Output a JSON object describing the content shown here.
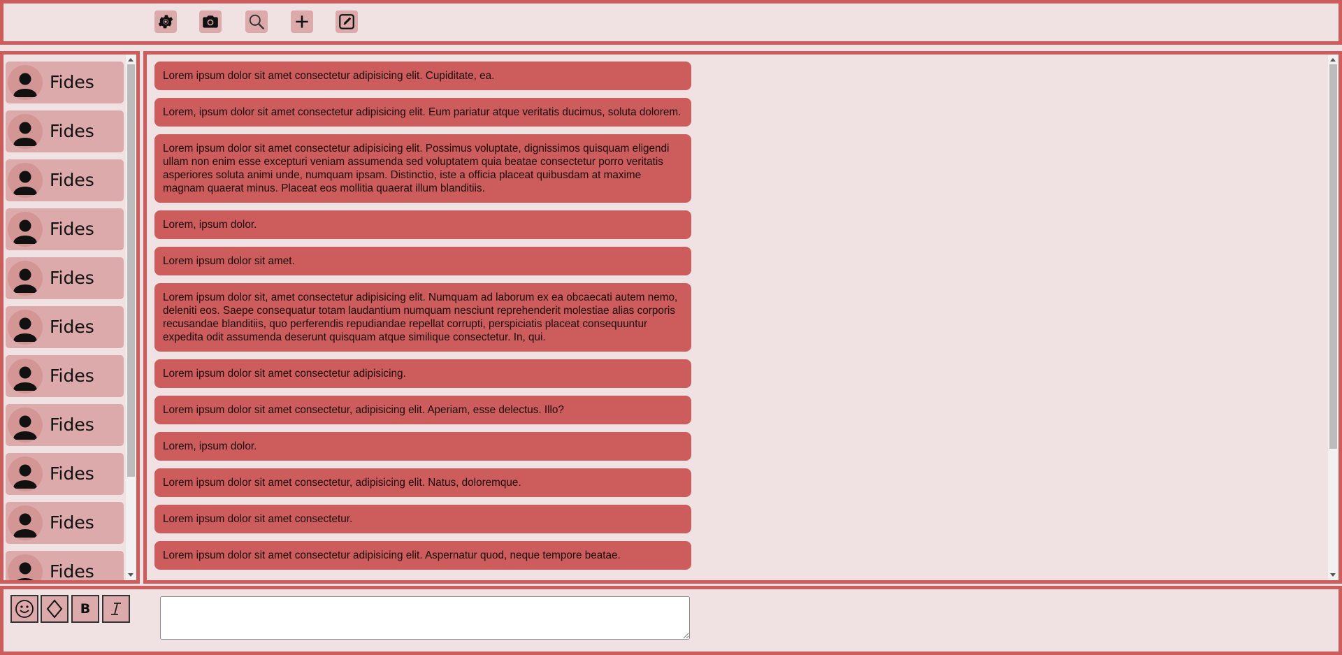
{
  "toolbar": {
    "icons": [
      "settings-icon",
      "camera-icon",
      "search-icon",
      "plus-icon",
      "edit-icon"
    ]
  },
  "sidebar": {
    "contacts": [
      {
        "name": "Fides"
      },
      {
        "name": "Fides"
      },
      {
        "name": "Fides"
      },
      {
        "name": "Fides"
      },
      {
        "name": "Fides"
      },
      {
        "name": "Fides"
      },
      {
        "name": "Fides"
      },
      {
        "name": "Fides"
      },
      {
        "name": "Fides"
      },
      {
        "name": "Fides"
      },
      {
        "name": "Fides"
      }
    ]
  },
  "messages": [
    "Lorem ipsum dolor sit amet consectetur adipisicing elit. Cupiditate, ea.",
    "Lorem, ipsum dolor sit amet consectetur adipisicing elit. Eum pariatur atque veritatis ducimus, soluta dolorem.",
    "Lorem ipsum dolor sit amet consectetur adipisicing elit. Possimus voluptate, dignissimos quisquam eligendi ullam non enim esse excepturi veniam assumenda sed voluptatem quia beatae consectetur porro veritatis asperiores soluta animi unde, numquam ipsam. Distinctio, iste a officia placeat quibusdam at maxime magnam quaerat minus. Placeat eos mollitia quaerat illum blanditiis.",
    "Lorem, ipsum dolor.",
    "Lorem ipsum dolor sit amet.",
    "Lorem ipsum dolor sit, amet consectetur adipisicing elit. Numquam ad laborum ex ea obcaecati autem nemo, deleniti eos. Saepe consequatur totam laudantium numquam nesciunt reprehenderit molestiae alias corporis recusandae blanditiis, quo perferendis repudiandae repellat corrupti, perspiciatis placeat consequuntur expedita odit assumenda deserunt quisquam atque similique consectetur. In, qui.",
    "Lorem ipsum dolor sit amet consectetur adipisicing.",
    "Lorem ipsum dolor sit amet consectetur, adipisicing elit. Aperiam, esse delectus. Illo?",
    "Lorem, ipsum dolor.",
    "Lorem ipsum dolor sit amet consectetur, adipisicing elit. Natus, doloremque.",
    "Lorem ipsum dolor sit amet consectetur.",
    "Lorem ipsum dolor sit amet consectetur adipisicing elit. Aspernatur quod, neque tempore beatae."
  ],
  "composer": {
    "buttons": [
      {
        "icon": "emoji-icon"
      },
      {
        "icon": "diamond-icon"
      },
      {
        "label": "B",
        "icon": "bold-icon"
      },
      {
        "icon": "italic-icon"
      }
    ],
    "input_value": "",
    "input_placeholder": ""
  },
  "colors": {
    "accent": "#cd5c5c",
    "background": "#f0e2e2",
    "item_bg": "#dcaaaa"
  }
}
